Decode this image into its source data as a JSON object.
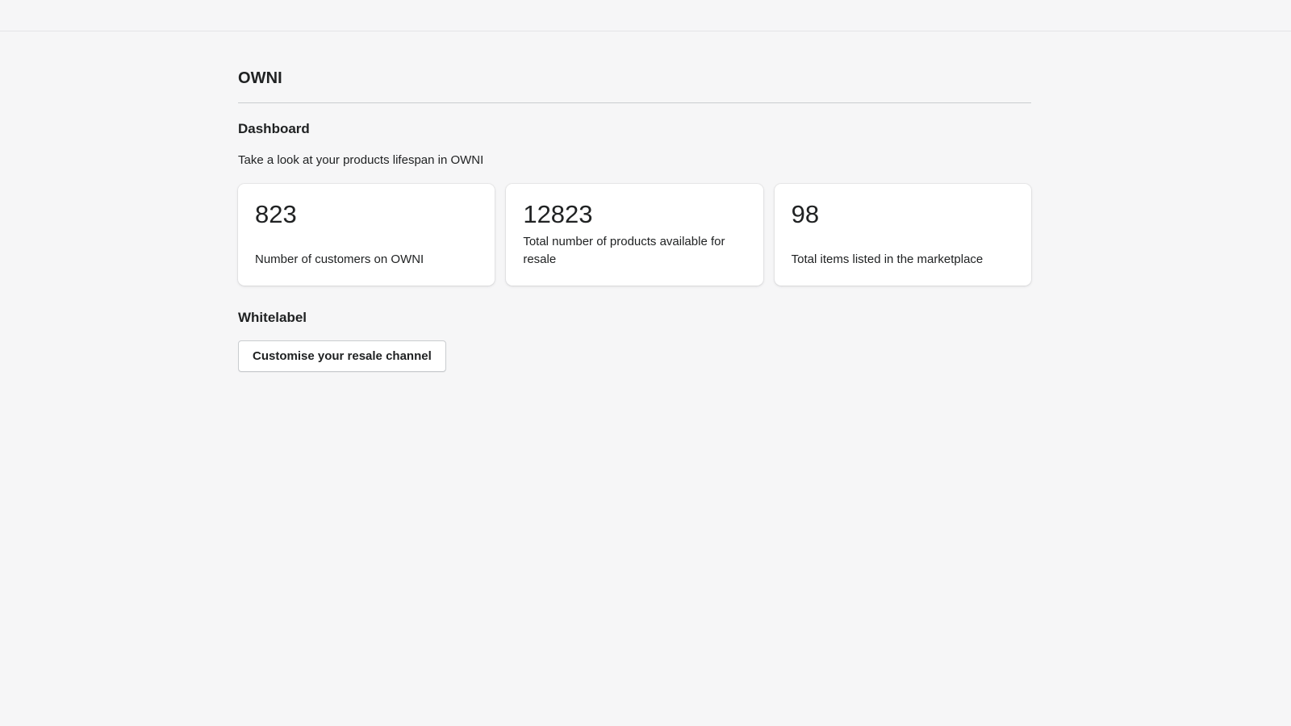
{
  "app": {
    "title": "OWNI"
  },
  "dashboard": {
    "heading": "Dashboard",
    "subtitle": "Take a look at your products lifespan in OWNI",
    "stats": [
      {
        "value": "823",
        "label": "Number of customers on OWNI"
      },
      {
        "value": "12823",
        "label": "Total number of products available for resale"
      },
      {
        "value": "98",
        "label": "Total items listed in the marketplace"
      }
    ]
  },
  "whitelabel": {
    "heading": "Whitelabel",
    "button_label": "Customise your resale channel"
  },
  "colors": {
    "background": "#f6f6f7",
    "card": "#ffffff",
    "text": "#202223",
    "divider": "#c9cccf"
  }
}
